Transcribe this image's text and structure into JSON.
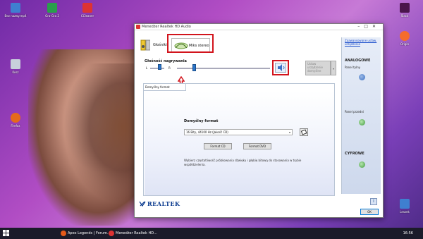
{
  "desktop": {
    "icons": [
      {
        "label": "Bez nazwy.mp4",
        "color": "#3f7fd0"
      },
      {
        "label": "Gra-Gra 2",
        "color": "#2a9f4c"
      },
      {
        "label": "CCleaner",
        "color": "#d33"
      },
      {
        "label": "Kosz",
        "color": "#c8d0db"
      },
      {
        "label": "Firefox",
        "color": "#e56a1a"
      },
      {
        "label": "Slack",
        "color": "#4a154b"
      },
      {
        "label": "Origin",
        "color": "#f56c2d"
      },
      {
        "label": "Leszek",
        "color": "#3f7fd0"
      }
    ]
  },
  "window": {
    "title": "Menedżer Realtek HD Audio",
    "tabs": [
      {
        "label": "Głośniki"
      },
      {
        "label": "Miks stereo"
      }
    ],
    "volume": {
      "label": "Głośność nagrywania",
      "left_label": "L",
      "right_label": "R",
      "level": 0.17
    },
    "set_default": {
      "label": "Ustaw urządzenie domyślne"
    },
    "panel": {
      "tab_label": "Domyślny format",
      "section_title": "Domyślny format",
      "format_value": "16 Bity, 44100 Hz (Jakość CD)",
      "btn_cd": "Format CD",
      "btn_dvd": "Format DVD",
      "note": "Wybierz częstotliwość próbkowania dźwięku i głębię bitową do stosowania w trybie współdzielenia."
    },
    "sidebar": {
      "advanced_link": "Zaawansowane ustaw. urządzenia",
      "analog_heading": "ANALOGOWE",
      "rear_panel": "Panel tylny",
      "front_panel": "Panel przedni",
      "digital_heading": "CYFROWE"
    },
    "logo": "REALTEK",
    "ok_label": "OK"
  },
  "taskbar": {
    "items": [
      {
        "label": "Apex Legends | Forum..."
      },
      {
        "label": "Menedżer Realtek HD..."
      }
    ],
    "clock": "16:56"
  }
}
